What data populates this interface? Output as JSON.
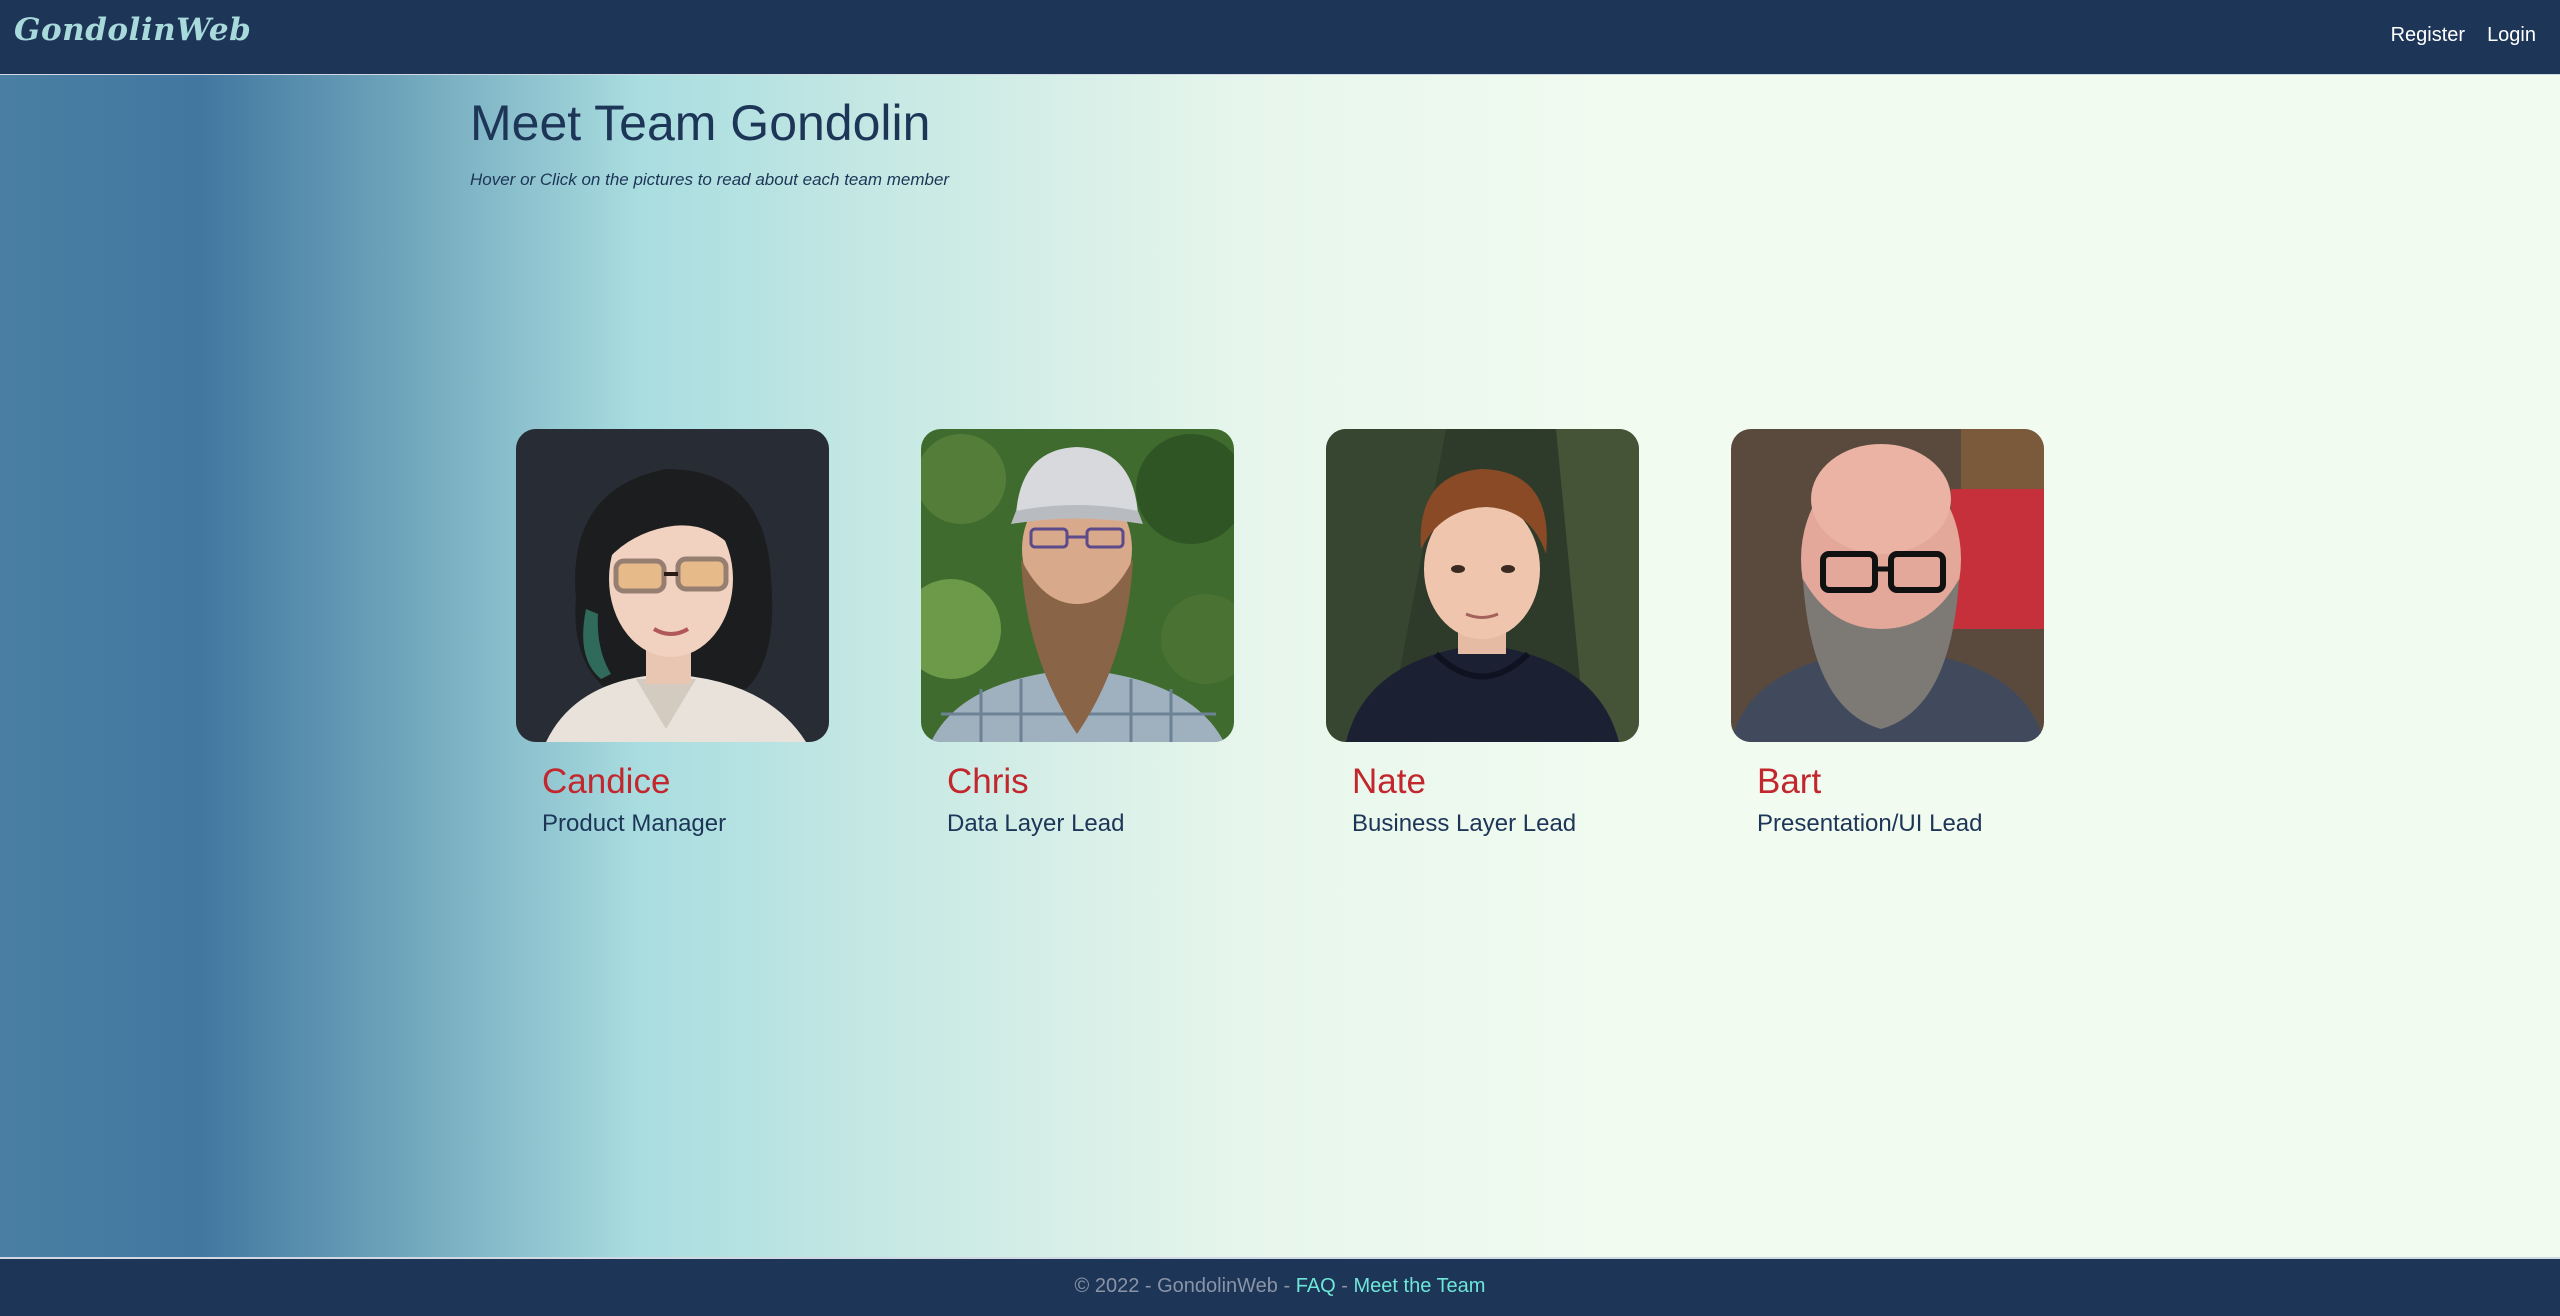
{
  "navbar": {
    "brand": "GondolinWeb",
    "links": [
      "Register",
      "Login"
    ]
  },
  "main": {
    "title": "Meet Team Gondolin",
    "subtitle": "Hover or Click on the pictures to read about each team member",
    "team": [
      {
        "name": "Candice",
        "role": "Product Manager"
      },
      {
        "name": "Chris",
        "role": "Data Layer Lead"
      },
      {
        "name": "Nate",
        "role": "Business Layer Lead"
      },
      {
        "name": "Bart",
        "role": "Presentation/UI Lead"
      }
    ]
  },
  "footer": {
    "copyright": "© 2022 - GondolinWeb -",
    "separator": "-",
    "faq": "FAQ",
    "meet_team": "Meet the Team"
  },
  "colors": {
    "navbar_bg": "#1d3557",
    "brand": "#a8dadc",
    "name_accent": "#c1272d",
    "text_dark": "#1d3557",
    "footer_link": "#6ee7d8"
  }
}
